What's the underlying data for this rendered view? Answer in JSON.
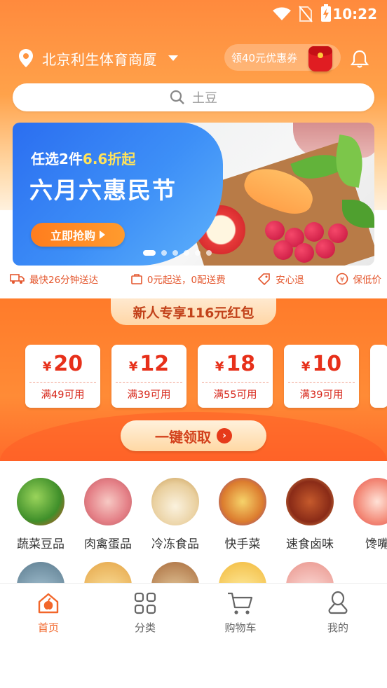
{
  "status_bar": {
    "time": "10:22"
  },
  "header": {
    "location": "北京利生体育商厦",
    "coupon_label": "领40元优惠券",
    "search_placeholder": "土豆"
  },
  "banner": {
    "subtitle_prefix": "任选2件",
    "subtitle_highlight": "6.6折起",
    "title": "六月六惠民节",
    "button_label": "立即抢购",
    "page_count": 6,
    "active_page": 1
  },
  "features": [
    {
      "icon": "truck-icon",
      "label": "最快26分钟送达"
    },
    {
      "icon": "bag-icon",
      "label": "0元起送，0配送费"
    },
    {
      "icon": "shield-tag-icon",
      "label": "安心退"
    },
    {
      "icon": "yuan-icon",
      "label": "保低价"
    }
  ],
  "promo": {
    "title": "新人专享116元红包",
    "currency": "¥",
    "coupons": [
      {
        "amount": "20",
        "condition": "满49可用"
      },
      {
        "amount": "12",
        "condition": "满39可用"
      },
      {
        "amount": "18",
        "condition": "满55可用"
      },
      {
        "amount": "10",
        "condition": "满39可用"
      }
    ],
    "claim_label": "一键领取"
  },
  "categories": [
    {
      "label": "蔬菜豆品"
    },
    {
      "label": "肉禽蛋品"
    },
    {
      "label": "冷冻食品"
    },
    {
      "label": "快手菜"
    },
    {
      "label": "速食卤味"
    },
    {
      "label": "馋嘴"
    }
  ],
  "tabbar": [
    {
      "label": "首页",
      "icon": "home-icon",
      "active": true
    },
    {
      "label": "分类",
      "icon": "grid-icon",
      "active": false
    },
    {
      "label": "购物车",
      "icon": "cart-icon",
      "active": false
    },
    {
      "label": "我的",
      "icon": "user-icon",
      "active": false
    }
  ],
  "colors": {
    "accent": "#f2662a",
    "promo_red": "#e7301a",
    "banner_blue": "#2b6ef0"
  }
}
